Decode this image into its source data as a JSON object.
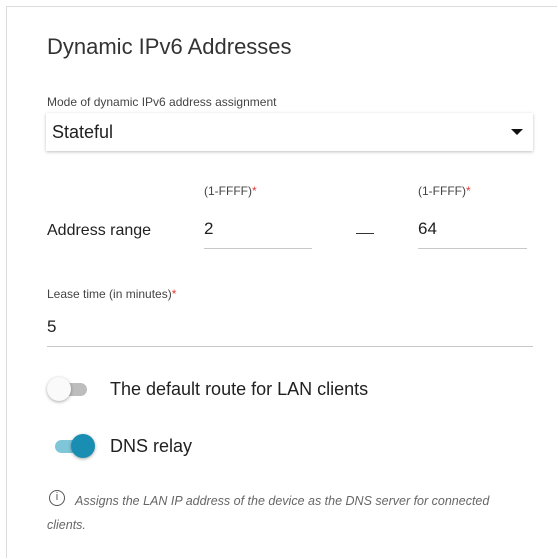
{
  "section": {
    "title": "Dynamic IPv6 Addresses"
  },
  "mode": {
    "label": "Mode of dynamic IPv6 address assignment",
    "selected": "Stateful",
    "caret_icon": "caret-down-icon"
  },
  "address_range": {
    "label": "Address range",
    "start": {
      "hint": "(1-FFFF)",
      "required_mark": "*",
      "value": "2"
    },
    "separator": "—",
    "end": {
      "hint": "(1-FFFF)",
      "required_mark": "*",
      "value": "64"
    }
  },
  "lease_time": {
    "label": "Lease time (in minutes)",
    "required_mark": "*",
    "value": "5"
  },
  "default_route": {
    "label": "The default route for LAN clients",
    "enabled": false
  },
  "dns_relay": {
    "label": "DNS relay",
    "enabled": true
  },
  "info": {
    "icon": "info-icon",
    "glyph": "i",
    "text": "Assigns the LAN IP address of the device as the DNS server for connected clients."
  },
  "colors": {
    "accent": "#1a8db3",
    "required": "#e53935"
  }
}
